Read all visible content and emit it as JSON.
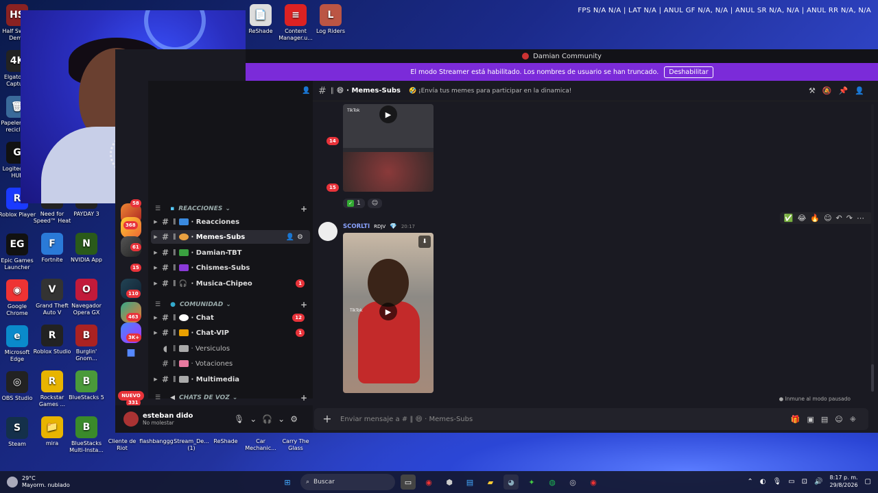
{
  "stats_overlay": "FPS N/A N/A | LAT N/A | ANUL GF N/A, N/A | ANUL SR N/A, N/A | ANUL RR N/A, N/A",
  "desktop_icons_left": [
    {
      "label": "Half Sword Demo",
      "color": "#8a2222",
      "glyph": "HS"
    },
    {
      "label": "Elgato 4K Capture",
      "color": "#222",
      "glyph": "4K"
    },
    {
      "label": "Papelera de reciclaje",
      "color": "#3a6a9a",
      "glyph": "🗑"
    },
    {
      "label": "Logitech G HUB",
      "color": "#111",
      "glyph": "G"
    },
    {
      "label": "Roblox Player",
      "color": "#1a3aff",
      "glyph": "R"
    },
    {
      "label": "Epic Games Launcher",
      "color": "#111",
      "glyph": "EG"
    },
    {
      "label": "Google Chrome",
      "color": "#e33",
      "glyph": "◉"
    },
    {
      "label": "Microsoft Edge",
      "color": "#0a8acb",
      "glyph": "e"
    },
    {
      "label": "OBS Studio",
      "color": "#222",
      "glyph": "◎"
    },
    {
      "label": "Steam",
      "color": "#14304a",
      "glyph": "S"
    }
  ],
  "desktop_icons_col2": [
    {
      "label": "Need for Speed™ Heat",
      "color": "#222",
      "glyph": "N"
    },
    {
      "label": "Fortnite",
      "color": "#2a7ad8",
      "glyph": "F"
    },
    {
      "label": "Grand Theft Auto V",
      "color": "#333",
      "glyph": "V"
    },
    {
      "label": "Roblox Studio",
      "color": "#222",
      "glyph": "R"
    },
    {
      "label": "Rockstar Games ...",
      "color": "#e8b400",
      "glyph": "R"
    },
    {
      "label": "mira",
      "color": "#e8b400",
      "glyph": "📁"
    }
  ],
  "desktop_icons_col3": [
    {
      "label": "PAYDAY 3",
      "color": "#222",
      "glyph": "P"
    },
    {
      "label": "NVIDIA App",
      "color": "#2a5a1a",
      "glyph": "N"
    },
    {
      "label": "Navegador Opera GX",
      "color": "#c21a3a",
      "glyph": "O"
    },
    {
      "label": "Burglin' Gnom...",
      "color": "#a22",
      "glyph": "B"
    },
    {
      "label": "BlueStacks 5",
      "color": "#4a9a3a",
      "glyph": "B"
    },
    {
      "label": "BlueStacks Multi-Insta...",
      "color": "#3a8a2a",
      "glyph": "B"
    }
  ],
  "desktop_icons_top": [
    {
      "label": "ReShade",
      "color": "#ddd",
      "glyph": "📄"
    },
    {
      "label": "Content Manager.u...",
      "color": "#d22",
      "glyph": "≡"
    },
    {
      "label": "Log Riders",
      "color": "#b54",
      "glyph": "L"
    }
  ],
  "desktop_bottom_row": [
    "Cliente de Riot",
    "flashbanggg",
    "Stream_De... (1)",
    "ReShade",
    "Car Mechanic...",
    "Carry The Glass"
  ],
  "titlebar": {
    "title": "Damian Community"
  },
  "streamer_bar": {
    "message": "El modo Streamer está habilitado. Los nombres de usuario se han truncado.",
    "button": "Deshabilitar"
  },
  "server_badges": [
    "58",
    "368",
    "61",
    "15",
    "110",
    "463",
    "3K+",
    "331"
  ],
  "new_pill": "NUEVO",
  "sidebar_counts": [
    "14",
    "15"
  ],
  "categories": {
    "reacciones": "REACCIONES",
    "comunidad": "COMUNIDAD",
    "chats_voz": "CHATS DE VOZ"
  },
  "channels": [
    {
      "name": "Reacciones",
      "color": "#3a8adf",
      "count": ""
    },
    {
      "name": "Memes-Subs",
      "color": "#e8a040",
      "count": ""
    },
    {
      "name": "Damian-TBT",
      "color": "#3aa040",
      "count": ""
    },
    {
      "name": "Chismes-Subs",
      "color": "#8a3ad8",
      "count": ""
    },
    {
      "name": "Musica-Chipeo",
      "color": "#888",
      "count": "1"
    },
    {
      "name": "Chat",
      "color": "#fff",
      "count": "12"
    },
    {
      "name": "Chat-VIP",
      "color": "#e8a000",
      "count": "1"
    },
    {
      "name": "Versiculos",
      "color": "#aaa",
      "count": ""
    },
    {
      "name": "Votaciones",
      "color": "#e87aa0",
      "count": ""
    },
    {
      "name": "Multimedia",
      "color": "#aaa",
      "count": ""
    }
  ],
  "user": {
    "name": "esteban dido",
    "status": "No molestar"
  },
  "chat_header": {
    "channel": "Memes-Subs",
    "topic": "¡Envía tus memes para participar en la dinamica!"
  },
  "reaction": {
    "count": "1"
  },
  "message": {
    "author": "SCORLTI",
    "tag": "RDJV",
    "time": "20:17"
  },
  "video_brand": "TikTok",
  "immune_note": "Inmune al modo pausado",
  "composer": {
    "placeholder": "Enviar mensaje a # ‖ 😄 · Memes-Subs"
  },
  "taskbar": {
    "weather_temp": "29°C",
    "weather_desc": "Mayorm. nublado",
    "search": "Buscar",
    "time": "8:17 p. m.",
    "date": "29/8/2026"
  }
}
